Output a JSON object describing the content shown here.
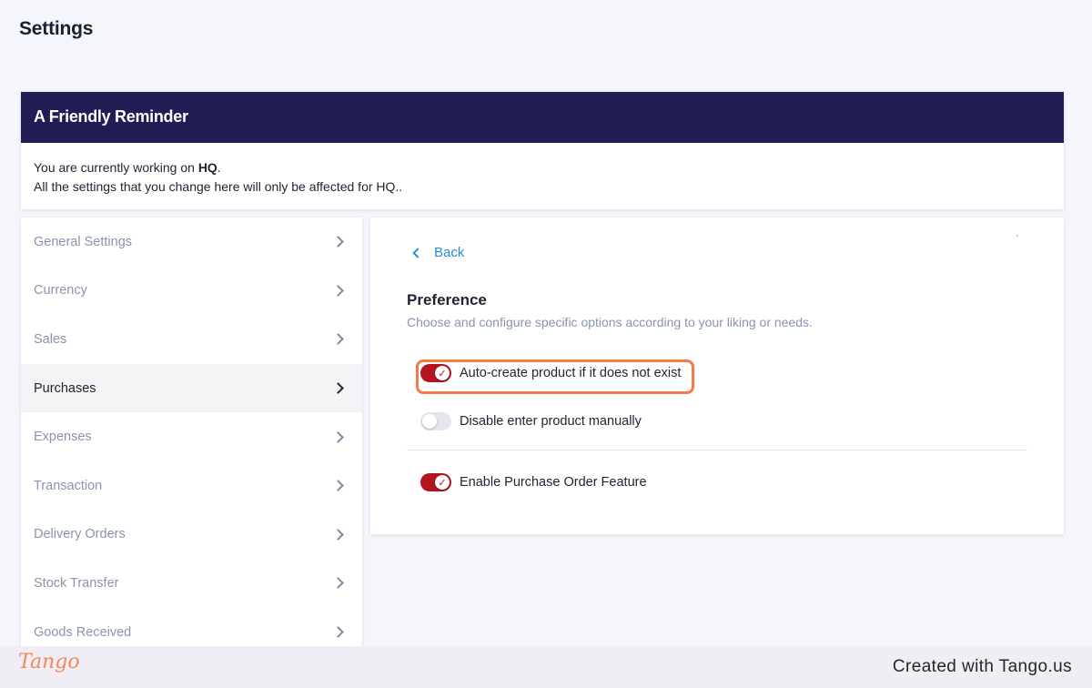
{
  "page": {
    "title": "Settings"
  },
  "reminder": {
    "title": "A Friendly Reminder",
    "line1_prefix": "You are currently working on ",
    "line1_bold": "HQ",
    "line1_suffix": ".",
    "line2": "All the settings that you change here will only be affected for HQ.."
  },
  "sidebar": {
    "items": [
      {
        "label": "General Settings",
        "active": false
      },
      {
        "label": "Currency",
        "active": false
      },
      {
        "label": "Sales",
        "active": false
      },
      {
        "label": "Purchases",
        "active": true
      },
      {
        "label": "Expenses",
        "active": false
      },
      {
        "label": "Transaction",
        "active": false
      },
      {
        "label": "Delivery Orders",
        "active": false
      },
      {
        "label": "Stock Transfer",
        "active": false
      },
      {
        "label": "Goods Received",
        "active": false
      }
    ]
  },
  "panel": {
    "back_label": "Back",
    "section_title": "Preference",
    "section_subtitle": "Choose and configure specific options according to your liking or needs.",
    "options": [
      {
        "label": "Auto-create product if it does not exist",
        "enabled": true,
        "highlighted": true
      },
      {
        "label": "Disable enter product manually",
        "enabled": false,
        "highlighted": false
      },
      {
        "label": "Enable Purchase Order Feature",
        "enabled": true,
        "highlighted": false
      }
    ]
  },
  "footer": {
    "logo_text": "Tango",
    "credit": "Created with Tango.us"
  },
  "colors": {
    "accent": "#b5141e",
    "header": "#1f1d54",
    "link": "#2a8bd6",
    "highlight": "#f47a4a"
  }
}
